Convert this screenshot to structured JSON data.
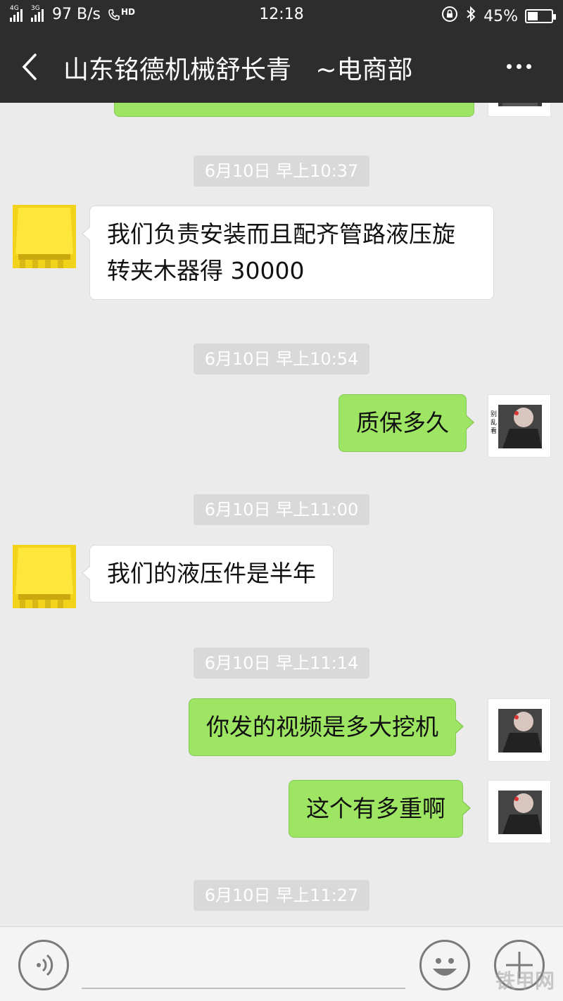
{
  "status_bar": {
    "net_tag_1": "4G",
    "net_tag_2": "3G",
    "speed": "97 B/s",
    "hd": "HD",
    "time": "12:18",
    "battery": "45%",
    "battery_level": 0.45
  },
  "header": {
    "title": "山东铭德机械舒长青   ~电商部",
    "back_icon": "chevron-left-icon",
    "more_icon": "more-dots-icon"
  },
  "messages": [
    {
      "type": "time",
      "text": "6月10日 早上10:37"
    },
    {
      "type": "in",
      "text": "我们负责安装而且配齐管路液压旋转夹木器得 30000"
    },
    {
      "type": "time",
      "text": "6月10日 早上10:54"
    },
    {
      "type": "out",
      "text": "质保多久"
    },
    {
      "type": "time",
      "text": "6月10日 早上11:00"
    },
    {
      "type": "in",
      "text": "我们的液压件是半年"
    },
    {
      "type": "time",
      "text": "6月10日 早上11:14"
    },
    {
      "type": "out",
      "text": "你发的视频是多大挖机"
    },
    {
      "type": "out",
      "text": "这个有多重啊"
    },
    {
      "type": "time",
      "text": "6月10日 早上11:27"
    }
  ],
  "avatar_self_text": "别乱看",
  "input_bar": {
    "voice_icon": "voice-icon",
    "emoji_icon": "emoji-icon",
    "plus_icon": "plus-icon"
  },
  "watermark": "铁甲网",
  "colors": {
    "header_bg": "#2d2d2d",
    "chat_bg": "#ebebeb",
    "out_bubble": "#9de563",
    "in_bubble": "#ffffff"
  }
}
